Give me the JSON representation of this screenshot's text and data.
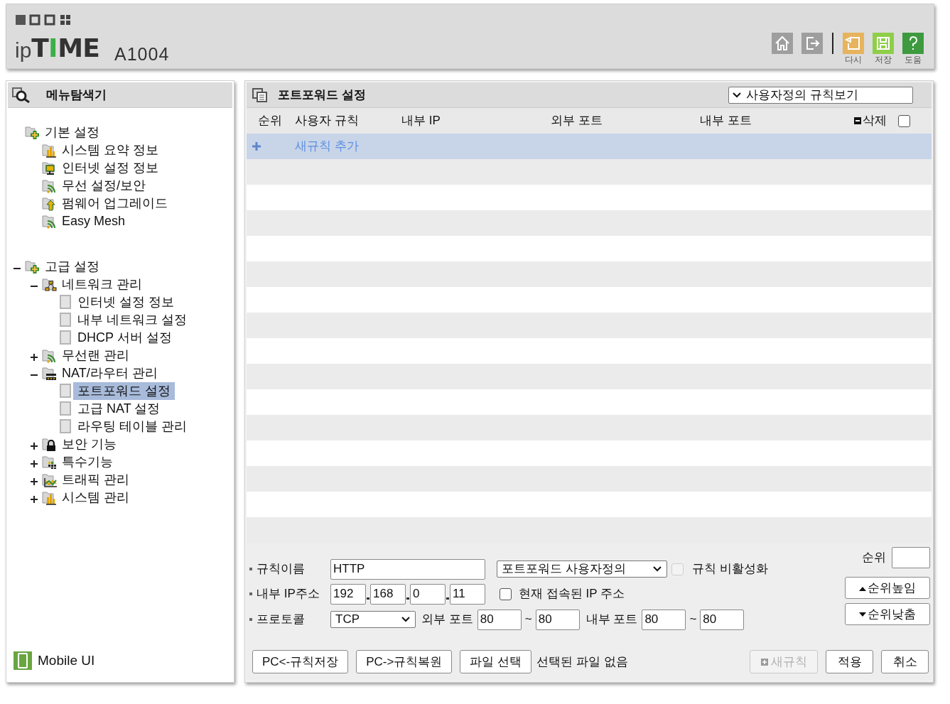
{
  "header": {
    "logo_parts": [
      {
        "text": "ip",
        "kind": "light"
      },
      {
        "text": "T",
        "kind": "bold"
      },
      {
        "text": "I",
        "kind": "accent"
      },
      {
        "text": "ME",
        "kind": "bold"
      }
    ],
    "model": "A1004",
    "tools": [
      {
        "kind": "home"
      },
      {
        "kind": "logout"
      },
      {
        "kind": "reload",
        "label": "다시"
      },
      {
        "kind": "save",
        "label": "저장"
      },
      {
        "kind": "help",
        "label": "도움"
      }
    ]
  },
  "sidebar": {
    "title": "메뉴탐색기",
    "tree": [
      {
        "label": "기본 설정",
        "kind": "folder-plus",
        "selected": false,
        "children": [
          {
            "label": "시스템 요약 정보",
            "kind": "chart",
            "selected": false
          },
          {
            "label": "인터넷 설정 정보",
            "kind": "monitor",
            "selected": false
          },
          {
            "label": "무선 설정/보안",
            "kind": "wifi",
            "selected": false
          },
          {
            "label": "펌웨어 업그레이드",
            "kind": "upload",
            "selected": false
          },
          {
            "label": "Easy Mesh",
            "kind": "wifi",
            "selected": false
          }
        ]
      },
      {
        "label": "고급 설정",
        "kind": "folder-plus",
        "selected": false,
        "expanded": true,
        "children": [
          {
            "label": "네트워크 관리",
            "kind": "network",
            "selected": false,
            "expanded": true,
            "children": [
              {
                "label": "인터넷 설정 정보",
                "kind": "page",
                "selected": false
              },
              {
                "label": "내부 네트워크 설정",
                "kind": "page",
                "selected": false
              },
              {
                "label": "DHCP 서버 설정",
                "kind": "page",
                "selected": false
              }
            ]
          },
          {
            "label": "무선랜 관리",
            "kind": "wifi",
            "selected": false,
            "expanded": false
          },
          {
            "label": "NAT/라우터 관리",
            "kind": "router",
            "selected": false,
            "expanded": true,
            "children": [
              {
                "label": "포트포워드 설정",
                "kind": "page",
                "selected": true
              },
              {
                "label": "고급 NAT 설정",
                "kind": "page",
                "selected": false
              },
              {
                "label": "라우팅 테이블 관리",
                "kind": "page",
                "selected": false
              }
            ]
          },
          {
            "label": "보안 기능",
            "kind": "lock",
            "selected": false,
            "expanded": false
          },
          {
            "label": "특수기능",
            "kind": "grid",
            "selected": false,
            "expanded": false
          },
          {
            "label": "트래픽 관리",
            "kind": "traffic",
            "selected": false,
            "expanded": false
          },
          {
            "label": "시스템 관리",
            "kind": "chart",
            "selected": false,
            "expanded": false
          }
        ]
      }
    ],
    "mobile_link": "Mobile UI"
  },
  "panel": {
    "title": "포트포워드 설정",
    "view_select": "사용자정의 규칙보기",
    "columns": [
      "순위",
      "사용자 규칙",
      "내부 IP",
      "외부 포트",
      "내부 포트",
      "삭제"
    ],
    "select_all_checked": false,
    "new_rule_row": "새규칙 추가",
    "form": {
      "name_label": "규칙이름",
      "name_value": "HTTP",
      "type_select": "포트포워드 사용자정의",
      "disable_label": "규칙 비활성화",
      "disable_checked": false,
      "disable_disabled": true,
      "ip_label": "내부 IP주소",
      "ip_parts": [
        "192",
        "168",
        "0",
        "11"
      ],
      "current_ip_label": "현재 접속된 IP 주소",
      "current_ip_checked": false,
      "protocol_label": "프로토콜",
      "protocol": "TCP",
      "ext_port_label": "외부 포트",
      "ext_from": "80",
      "ext_to": "80",
      "int_port_label": "내부 포트",
      "int_from": "80",
      "int_to": "80",
      "range_sep": "~",
      "order_label": "순위",
      "up_button": "순위높임",
      "down_button": "순위낮춤"
    },
    "buttons": [
      {
        "label": "PC<-규칙저장",
        "kind": "plain"
      },
      {
        "label": "PC->규칙복원",
        "kind": "plain"
      },
      {
        "label": "파일 선택",
        "kind": "plain"
      },
      {
        "label": "선택된 파일 없음",
        "kind": "note"
      },
      {
        "label": "새규칙",
        "kind": "new",
        "disabled": true
      },
      {
        "label": "적용",
        "kind": "plain"
      },
      {
        "label": "취소",
        "kind": "plain"
      }
    ]
  }
}
